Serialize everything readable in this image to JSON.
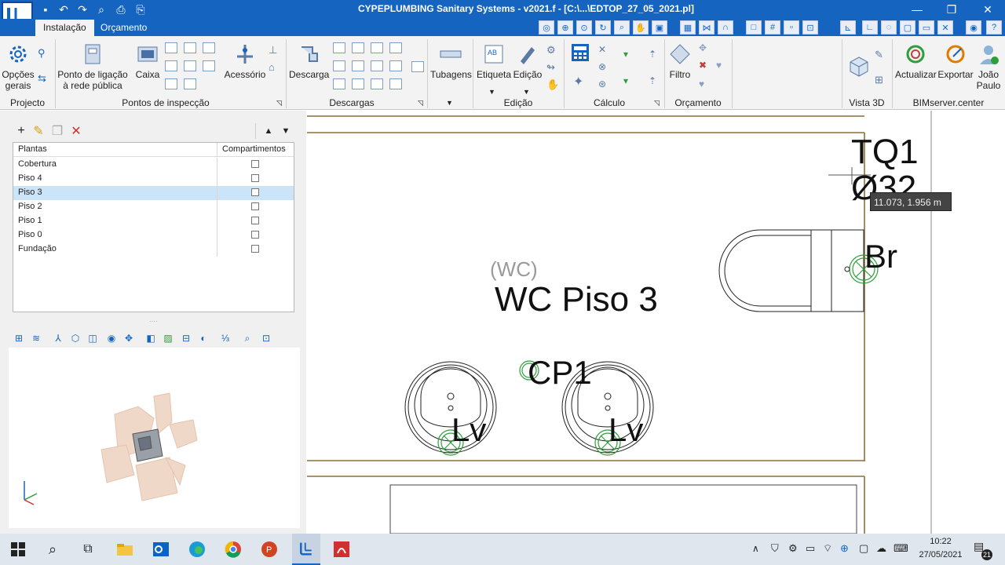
{
  "window": {
    "title": "CYPEPLUMBING Sanitary Systems - v2021.f - [C:\\...\\EDTOP_27_05_2021.pl]"
  },
  "tabs": [
    {
      "label": "Instalação",
      "active": true
    },
    {
      "label": "Orçamento",
      "active": false
    }
  ],
  "ribbon": {
    "buttons": {
      "opcoes": "Opções gerais",
      "ponto": "Ponto de ligação à rede pública",
      "caixa": "Caixa",
      "acessorio": "Acessório",
      "descarga": "Descarga",
      "tubagens": "Tubagens",
      "etiqueta": "Etiqueta",
      "edicao": "Edição",
      "filtro": "Filtro",
      "actualizar": "Actualizar",
      "exportar": "Exportar",
      "joao": "João Paulo"
    },
    "groups": {
      "projecto": "Projecto",
      "pontos": "Pontos de inspecção",
      "descargas": "Descargas",
      "edicao": "Edição",
      "calculo": "Cálculo",
      "orcamento": "Orçamento",
      "vista3d": "Vista 3D",
      "bim": "BIMserver.center"
    }
  },
  "plants_table": {
    "headers": {
      "name": "Plantas",
      "comp": "Compartimentos"
    },
    "rows": [
      {
        "name": "Cobertura",
        "selected": false
      },
      {
        "name": "Piso 4",
        "selected": false
      },
      {
        "name": "Piso 3",
        "selected": true
      },
      {
        "name": "Piso 2",
        "selected": false
      },
      {
        "name": "Piso 1",
        "selected": false
      },
      {
        "name": "Piso 0",
        "selected": false
      },
      {
        "name": "Fundação",
        "selected": false
      }
    ]
  },
  "drawing": {
    "room_type": "(WC)",
    "room_name": "WC Piso 3",
    "tq_label": "TQ1",
    "tq_diameter": "Ø32",
    "br_label": "Br",
    "cp_label": "CP1",
    "lv_label": "Lv",
    "coord_readout": "11.073, 1.956 m"
  },
  "taskbar": {
    "time": "10:22",
    "date": "27/05/2021",
    "notifications": "21"
  },
  "colors": {
    "accent": "#1565c0",
    "wall": "#8b6f3a",
    "valve": "#2e9e3a"
  }
}
